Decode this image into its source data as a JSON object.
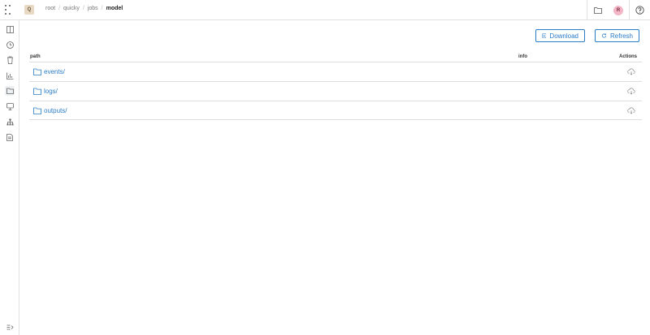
{
  "header": {
    "project_badge": "Q",
    "breadcrumbs": [
      "root",
      "quicky",
      "jobs",
      "model"
    ],
    "breadcrumb_sep": "/",
    "user_initial": "R",
    "icons": [
      "folder-icon",
      "help-icon"
    ]
  },
  "sidebar": {
    "items": [
      "panel-icon",
      "clock-icon",
      "trash-icon",
      "chart-icon",
      "file-explorer-icon",
      "dashboard-icon",
      "hierarchy-icon",
      "document-icon"
    ],
    "footer": "collapse-icon"
  },
  "toolbar": {
    "download_label": "Download",
    "refresh_label": "Refresh"
  },
  "table": {
    "columns": {
      "path": "path",
      "info": "info",
      "actions": "Actions"
    },
    "rows": [
      {
        "path": "events/"
      },
      {
        "path": "logs/"
      },
      {
        "path": "outputs/"
      }
    ]
  },
  "colors": {
    "accent": "#2a7cc7",
    "border": "#e1e1e1"
  }
}
